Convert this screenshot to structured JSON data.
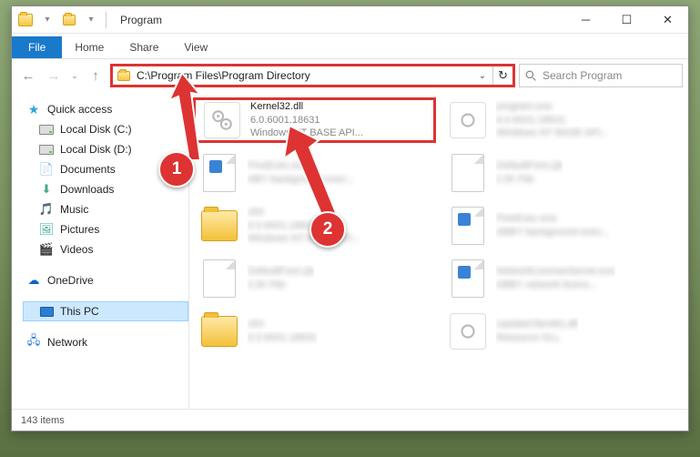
{
  "title": "Program",
  "ribbon": {
    "file": "File",
    "tabs": [
      "Home",
      "Share",
      "View"
    ]
  },
  "address": "C:\\Program Files\\Program Directory",
  "search_placeholder": "Search Program",
  "sidebar": {
    "quick": {
      "label": "Quick access",
      "items": [
        {
          "label": "Local Disk (C:)"
        },
        {
          "label": "Local Disk (D:)"
        },
        {
          "label": "Documents"
        },
        {
          "label": "Downloads"
        },
        {
          "label": "Music"
        },
        {
          "label": "Pictures"
        },
        {
          "label": "Videos"
        }
      ]
    },
    "onedrive": "OneDrive",
    "thispc": "This PC",
    "network": "Network"
  },
  "files": {
    "left": [
      {
        "name": "Kernel32.dll",
        "sub1": "6.0.6001.18631",
        "sub2": "Windows NT BASE API..."
      },
      {
        "name": "FineExec.exe",
        "sub1": "ABY background exec..."
      },
      {
        "name": "x64",
        "sub1": "6.0.6001.18631",
        "sub2": "Windows NT BASE API..."
      },
      {
        "name": "DefaultFont.cjk",
        "sub1": "CJK File"
      },
      {
        "name": "x64",
        "sub1": "6.0.6001.18631"
      }
    ],
    "right": [
      {
        "name": "program.exe",
        "sub1": "6.0.6001.18631",
        "sub2": "Windows NT BASE API..."
      },
      {
        "name": "DefaultFont.cjk",
        "sub1": "CJK File"
      },
      {
        "name": "FineExec.exe",
        "sub1": "ABBY background exec..."
      },
      {
        "name": "NetworkLicenseServer.exe",
        "sub1": "ABBY network licens..."
      },
      {
        "name": "UpdateClient61.dll",
        "sub1": "Resource DLL"
      }
    ]
  },
  "status": "143 items",
  "callouts": {
    "c1": "1",
    "c2": "2"
  }
}
